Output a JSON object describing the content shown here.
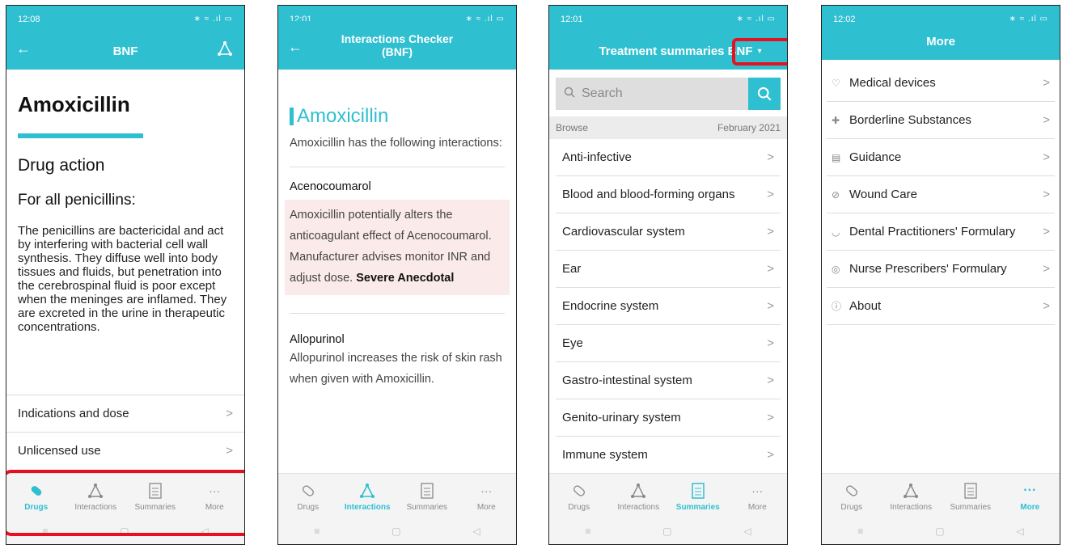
{
  "screens": [
    {
      "status_time": "12:08",
      "status_right": "∗ ≈ .ıl ▭",
      "appbar_title": "BNF",
      "drug_title": "Amoxicillin",
      "section": "Drug action",
      "subsection": "For all penicillins:",
      "body": "The penicillins are bactericidal and act by interfering with bacterial cell wall synthesis. They diffuse well into body tissues and fluids, but penetration into the cerebrospinal fluid is poor except when the meninges are inflamed. They are excreted in the urine in therapeutic concentrations.",
      "rows": [
        "Indications and dose",
        "Unlicensed use"
      ]
    },
    {
      "status_time": "12:01",
      "status_right": "∗ ≈ .ıl ▭",
      "appbar_title": "Interactions Checker (BNF)",
      "drug_title": "Amoxicillin",
      "intro": "Amoxicillin has the following interactions:",
      "interaction1_name": "Acenocoumarol",
      "interaction1_text": "Amoxicillin potentially alters the anticoagulant effect of Acenocoumarol. Manufacturer advises monitor INR and adjust dose.",
      "interaction1_severity": "Severe Anecdotal",
      "interaction2_name": "Allopurinol",
      "interaction2_text": "Allopurinol increases the risk of skin rash when given with Amoxicillin."
    },
    {
      "status_time": "12:01",
      "status_right": "∗ ≈ .ıl ▭",
      "appbar_title": "Treatment summaries BNF",
      "search_placeholder": "Search",
      "browse_label": "Browse",
      "browse_date": "February 2021",
      "items": [
        "Anti-infective",
        "Blood and blood-forming organs",
        "Cardiovascular system",
        "Ear",
        "Endocrine system",
        "Eye",
        "Gastro-intestinal system",
        "Genito-urinary system",
        "Immune system"
      ]
    },
    {
      "status_time": "12:02",
      "status_right": "∗ ≈ .ıl ▭",
      "appbar_title": "More",
      "items": [
        "Medical devices",
        "Borderline Substances",
        "Guidance",
        "Wound Care",
        "Dental Practitioners' Formulary",
        "Nurse Prescribers' Formulary",
        "About"
      ]
    }
  ],
  "tabs": [
    "Drugs",
    "Interactions",
    "Summaries",
    "More"
  ],
  "nav_glyphs": [
    "≡",
    "▢",
    "◁"
  ],
  "colors": {
    "accent": "#2ebfd1",
    "highlight": "#e8101e"
  }
}
